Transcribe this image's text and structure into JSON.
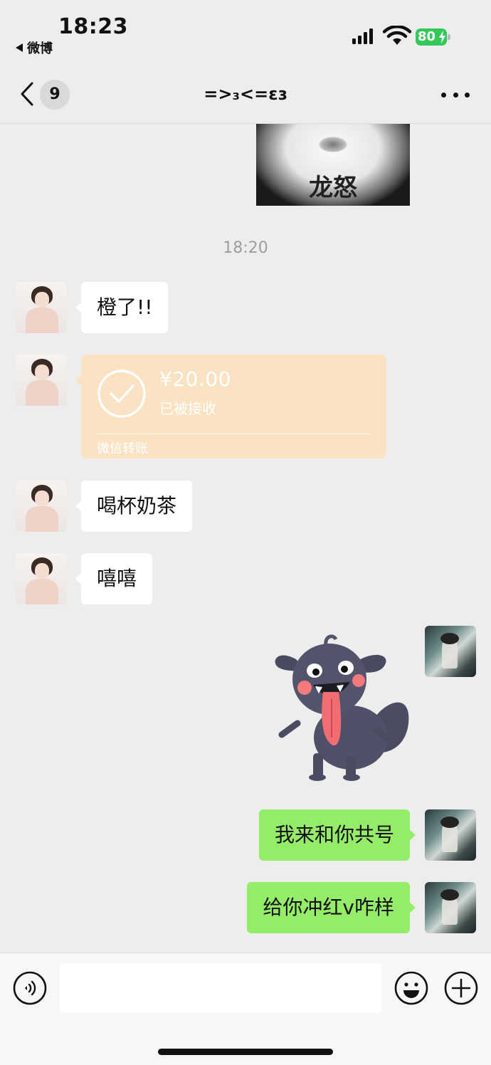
{
  "status_bar": {
    "time": "18:23",
    "back_app": "微博",
    "battery": "80",
    "signal_icon": "cellular-signal-icon",
    "wifi_icon": "wifi-icon",
    "battery_icon": "battery-charging-icon"
  },
  "nav": {
    "back_icon": "chevron-left-icon",
    "unread_count": "9",
    "title": "=>₃<=ɛɜ",
    "more_icon": "ellipsis-icon"
  },
  "sticker_top": {
    "caption": "龙怒"
  },
  "timestamp": "18:20",
  "messages": [
    {
      "side": "in",
      "type": "text",
      "text": "橙了!!"
    },
    {
      "side": "in",
      "type": "transfer",
      "amount": "¥20.00",
      "status": "已被接收",
      "label": "微信转账",
      "icon": "check-circle-icon"
    },
    {
      "side": "in",
      "type": "text",
      "text": "喝杯奶茶"
    },
    {
      "side": "in",
      "type": "text",
      "text": "嘻嘻"
    },
    {
      "side": "out",
      "type": "sticker",
      "sticker": "tongue-out-monster-sticker"
    },
    {
      "side": "out",
      "type": "text",
      "text": "我来和你共号"
    },
    {
      "side": "out",
      "type": "text",
      "text": "给你冲红v咋样"
    }
  ],
  "input_bar": {
    "voice_icon": "voice-icon",
    "input_value": "",
    "emoji_icon": "smiley-icon",
    "plus_icon": "plus-circle-icon"
  },
  "colors": {
    "background": "#ededed",
    "incoming_bubble": "#ffffff",
    "outgoing_bubble": "#95ec69",
    "transfer_card": "#fbe2c3",
    "battery": "#34c759"
  }
}
